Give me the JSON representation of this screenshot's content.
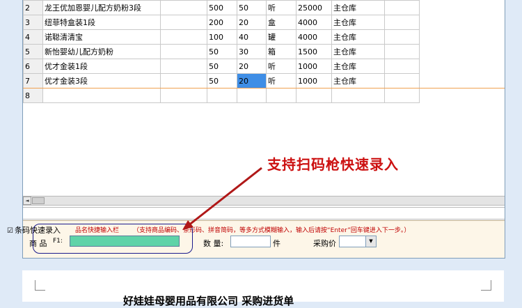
{
  "grid": {
    "rows": [
      {
        "num": "2",
        "name": "龙王优加恩婴儿配方奶粉3段",
        "c1": "",
        "c2": "500",
        "c3": "50",
        "unit": "听",
        "amount": "25000",
        "warehouse": "主仓库"
      },
      {
        "num": "3",
        "name": "纽菲特盒装1段",
        "c1": "",
        "c2": "200",
        "c3": "20",
        "unit": "盒",
        "amount": "4000",
        "warehouse": "主仓库"
      },
      {
        "num": "4",
        "name": "诺聪清清宝",
        "c1": "",
        "c2": "100",
        "c3": "40",
        "unit": "罐",
        "amount": "4000",
        "warehouse": "主仓库"
      },
      {
        "num": "5",
        "name": "新怡婴幼儿配方奶粉",
        "c1": "",
        "c2": "50",
        "c3": "30",
        "unit": "箱",
        "amount": "1500",
        "warehouse": "主仓库"
      },
      {
        "num": "6",
        "name": "优才金装1段",
        "c1": "",
        "c2": "50",
        "c3": "20",
        "unit": "听",
        "amount": "1000",
        "warehouse": "主仓库"
      },
      {
        "num": "7",
        "name": "优才金装3段",
        "c1": "",
        "c2": "50",
        "c3": "20",
        "unit": "听",
        "amount": "1000",
        "warehouse": "主仓库"
      },
      {
        "num": "8",
        "name": "",
        "c1": "",
        "c2": "",
        "c3": "",
        "unit": "",
        "amount": "",
        "warehouse": ""
      }
    ],
    "selected": {
      "row": "7",
      "column": "c3"
    }
  },
  "annotation": "支持扫码枪快速录入",
  "panel": {
    "checkbox_glyph": "☑",
    "checkbox_label": "条码快速录入",
    "checkbox_checked": true,
    "hint_title": "品名快捷输入栏",
    "hint_detail": "（支持商品编码、条形码、拼音简码，等多方式模糊输入，输入后请按“Enter”回车键进入下一步。）",
    "product_label": "商 品",
    "product_code_label": "F1:",
    "product_value": "",
    "quantity_label": "数 量:",
    "quantity_value": "",
    "quantity_unit": "件",
    "price_label": "采购价",
    "price_value": ""
  },
  "scrollbar": {
    "left_arrow": "◄"
  },
  "document": {
    "title": "好娃娃母婴用品有限公司  采购进货单"
  },
  "colors": {
    "selected_cell": "#3f8ee6",
    "product_input": "#5fd3a8",
    "annotation": "#cc1010",
    "background": "#dfeaf7"
  }
}
